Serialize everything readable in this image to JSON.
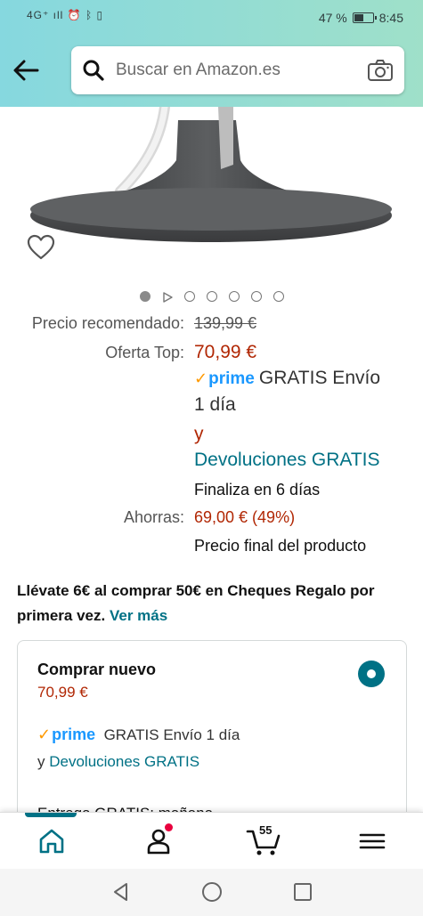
{
  "status_bar": {
    "signal": "4G⁺ ıll",
    "battery_text": "47 %",
    "battery_level": 0.47,
    "time": "8:45"
  },
  "search": {
    "placeholder": "Buscar en Amazon.es",
    "icons": [
      "back-arrow-icon",
      "search-icon",
      "camera-icon"
    ]
  },
  "carousel": {
    "total_images": 7,
    "active_index": 0,
    "has_video": true
  },
  "pricing": {
    "recommended_label": "Precio recomendado:",
    "recommended_price": "139,99 €",
    "offer_label": "Oferta Top:",
    "offer_price": "70,99 €",
    "prime_word": "prime",
    "shipping_line1": "GRATIS Envío",
    "shipping_line2": "1 día",
    "and": "y",
    "returns": "Devoluciones GRATIS",
    "ends": "Finaliza en 6 días",
    "savings_label": "Ahorras:",
    "savings_value": "69,00 € (49%)",
    "final_price_note": "Precio final del producto"
  },
  "promo": {
    "text": "Llévate 6€ al comprar 50€ en Cheques Regalo por primera vez.",
    "link": "Ver más"
  },
  "buy_box": {
    "title": "Comprar nuevo",
    "price": "70,99 €",
    "prime_word": "prime",
    "shipping": "GRATIS Envío 1 día",
    "and": "y",
    "returns": "Devoluciones GRATIS",
    "delivery_partial": "Entrega GRATIS: mañana"
  },
  "bottom_nav": {
    "cart_count": "55",
    "items": [
      "home-icon",
      "account-icon",
      "cart-icon",
      "menu-icon"
    ]
  },
  "colors": {
    "header_start": "#86d8df",
    "header_end": "#9fe0c9",
    "price_red": "#b12704",
    "link_teal": "#007185",
    "prime_blue": "#1a98ff",
    "prime_orange": "#ff9900"
  }
}
